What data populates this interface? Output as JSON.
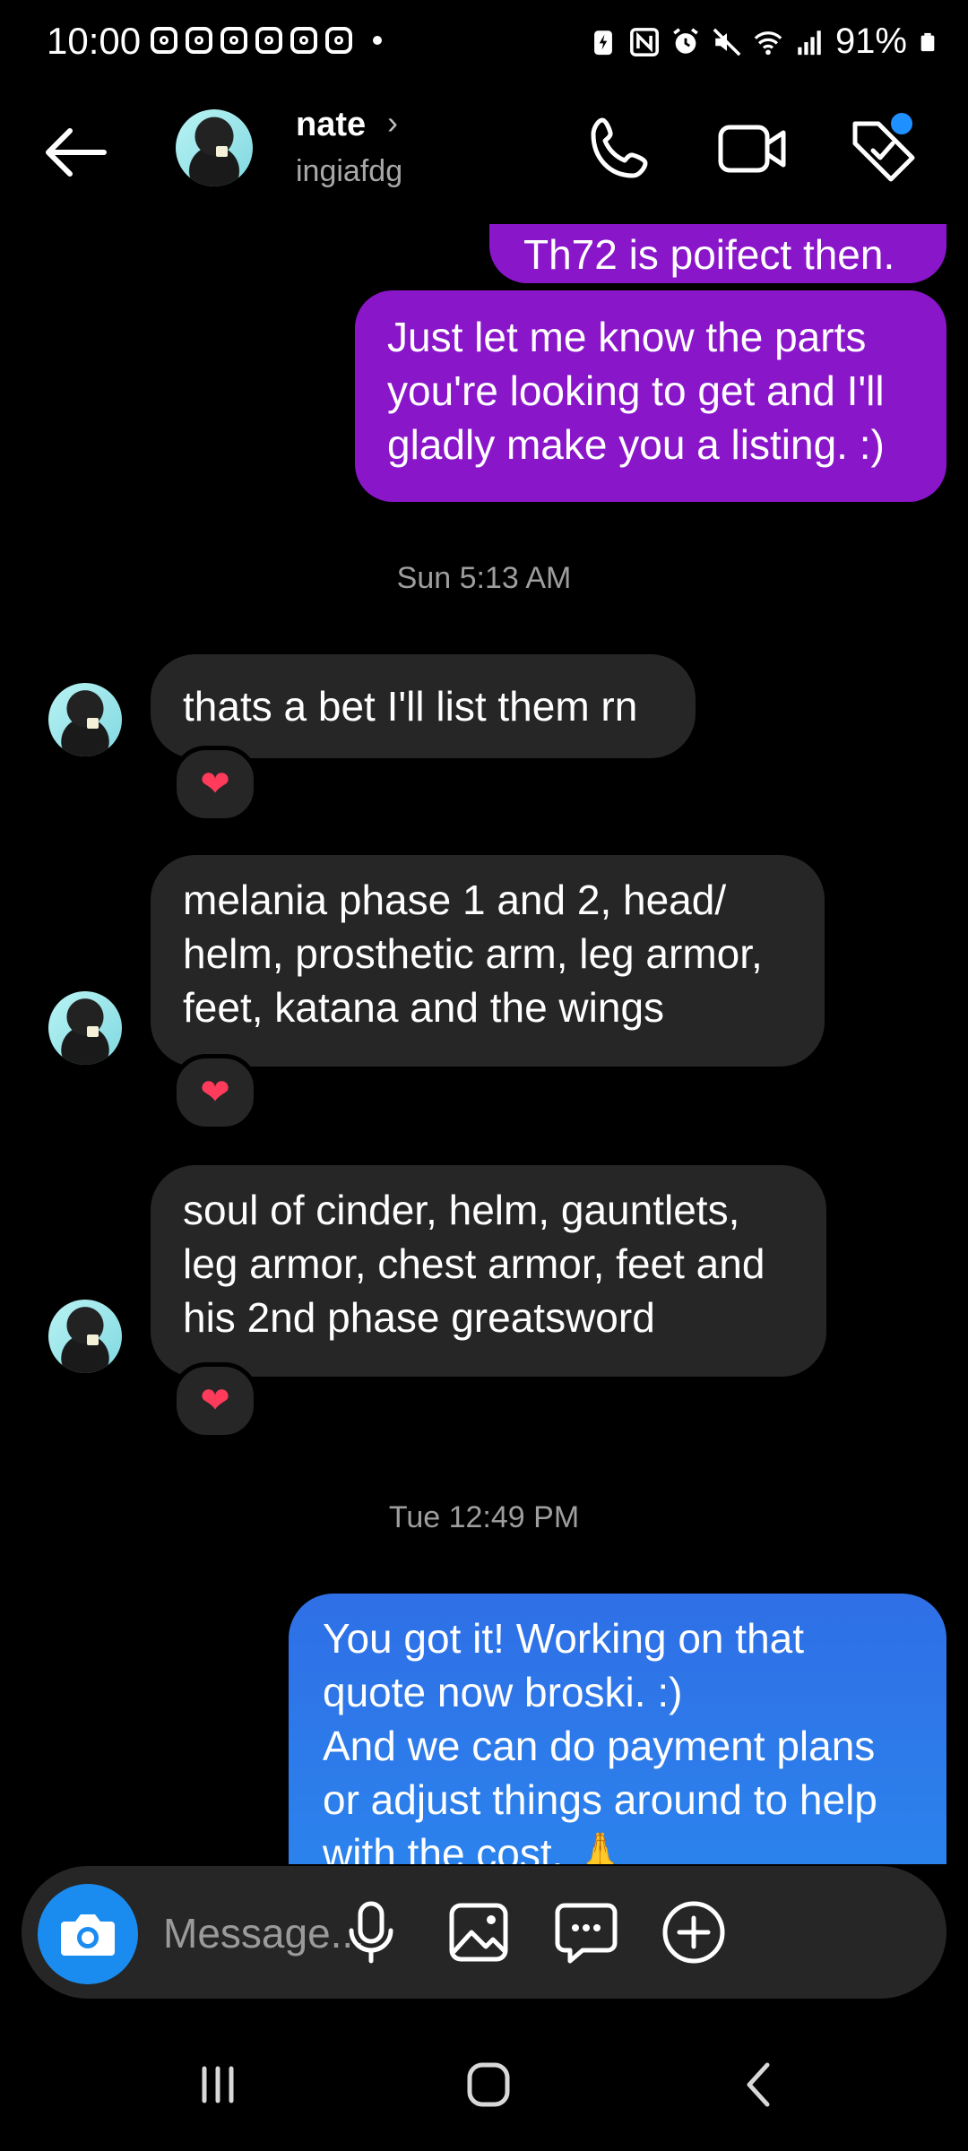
{
  "status_bar": {
    "time": "10:00",
    "battery": "91%"
  },
  "header": {
    "name": "nate",
    "username": "ingiafdg"
  },
  "messages": {
    "partial_text": "Th72 is poifect then.",
    "msg1": [
      "Just let me know the parts",
      "you're looking to get and I'll",
      "gladly make you a listing. :)"
    ],
    "ts1": "Sun 5:13 AM",
    "msg2": "thats a bet I'll list them rn",
    "msg3": [
      "melania phase 1 and 2, head/",
      "helm, prosthetic arm, leg armor,",
      "feet, katana and the wings"
    ],
    "msg4": [
      "soul of cinder, helm, gauntlets,",
      "leg armor, chest armor, feet and",
      "his 2nd phase greatsword"
    ],
    "ts2": "Tue 12:49 PM",
    "msg5": [
      "You got it! Working on that",
      "quote now broski. :)",
      "And we can do payment plans",
      "or adjust things around to help",
      "with the cost. 🙏"
    ],
    "reaction": "❤"
  },
  "composer": {
    "placeholder": "Message..."
  },
  "colors": {
    "outgoing_purple": "#8a16c9",
    "outgoing_blue": "#2f7ae8",
    "incoming": "#262626",
    "accent": "#1a8cf0"
  }
}
